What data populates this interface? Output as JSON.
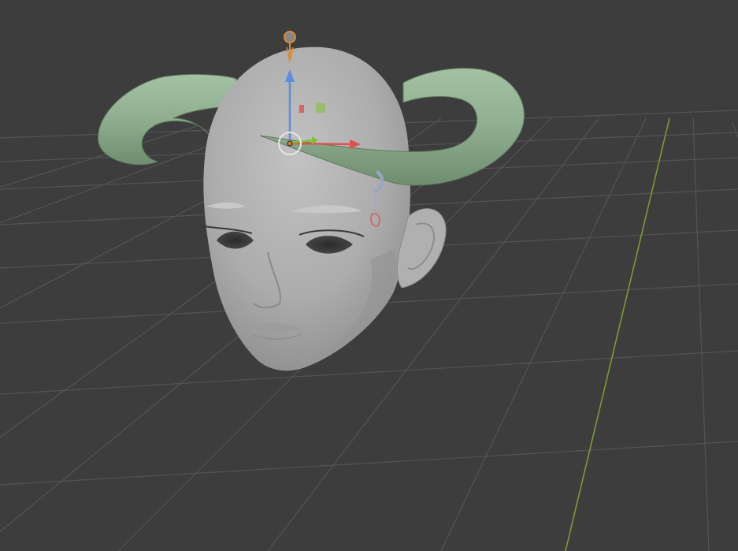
{
  "viewport": {
    "background": "#3d3d3d",
    "grid_color": "#545454",
    "y_axis_color": "#7a9c2e"
  },
  "scene": {
    "skin_color": "#b4b4b4",
    "horn_color": "#8fae8f",
    "earring_color": "#9aa6c4",
    "charm_color": "#c9706c"
  },
  "gizmo": {
    "origin_ring_color": "#e6e6e6",
    "origin_dot_color": "#e07a1f",
    "x_axis_color": "#e05050",
    "y_axis_color": "#7fc23a",
    "z_axis_color": "#5a8ee0",
    "light_marker_color": "#e08a30",
    "icons": [
      "move-gizmo-icon",
      "light-empty-icon"
    ]
  }
}
